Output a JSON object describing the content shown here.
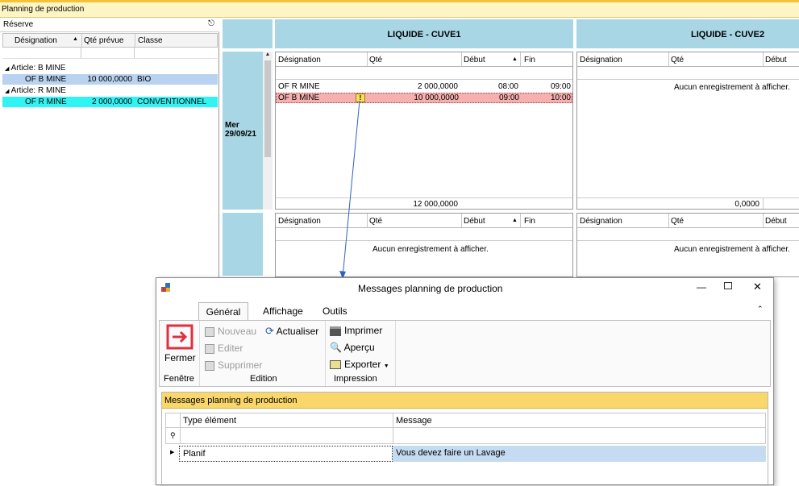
{
  "window_title": "Planning de production",
  "reserve": {
    "title": "Réserve",
    "cols": [
      "Désignation",
      "Qté prévue",
      "Classe"
    ],
    "groups": [
      {
        "label": "Article: B MINE",
        "row": {
          "des": "OF B MINE",
          "qte": "10 000,0000",
          "classe": "BIO"
        }
      },
      {
        "label": "Article: R MINE",
        "row": {
          "des": "OF R MINE",
          "qte": "2 000,0000",
          "classe": "CONVENTIONNEL"
        }
      }
    ]
  },
  "day": {
    "label": "Mer\n29/09/21"
  },
  "cuve1": {
    "title": "LIQUIDE - CUVE1",
    "cols": [
      "Désignation",
      "Qté",
      "Début",
      "Fin"
    ],
    "rows": [
      {
        "des": "OF R MINE",
        "qte": "2 000,0000",
        "debut": "08:00",
        "fin": "09:00"
      },
      {
        "des": "OF B MINE",
        "qte": "10 000,0000",
        "debut": "09:00",
        "fin": "10:00"
      }
    ],
    "total": "12 000,0000",
    "second_cols": [
      "Désignation",
      "Qté",
      "Début",
      "Fin"
    ],
    "second_empty": "Aucun enregistrement à afficher."
  },
  "cuve2": {
    "title": "LIQUIDE - CUVE2",
    "cols": [
      "Désignation",
      "Qté",
      "Début"
    ],
    "empty": "Aucun enregistrement à afficher.",
    "total": "0,0000",
    "second_cols": [
      "Désignation",
      "Qté",
      "Début"
    ],
    "second_empty": "Aucun enregistrement à afficher."
  },
  "dialog": {
    "title": "Messages planning de production",
    "tabs": [
      "Général",
      "Affichage",
      "Outils"
    ],
    "fermer": "Fermer",
    "nouveau": "Nouveau",
    "editer": "Editer",
    "supprimer": "Supprimer",
    "actualiser": "Actualiser",
    "imprimer": "Imprimer",
    "apercu": "Aperçu",
    "exporter": "Exporter",
    "groups": [
      "Fenêtre",
      "Edition",
      "Impression"
    ],
    "grid_title": "Messages planning de production",
    "grid_cols": [
      "Type élément",
      "Message"
    ],
    "rows": [
      {
        "type": "Planif",
        "message": "Vous devez faire un Lavage"
      }
    ]
  },
  "colors": {
    "accent": "#f2c33a",
    "header_blue": "#a8d6e4",
    "error_row": "#f6b0b0",
    "selected": "#b8d2f0",
    "cyan": "#30f4f4"
  }
}
